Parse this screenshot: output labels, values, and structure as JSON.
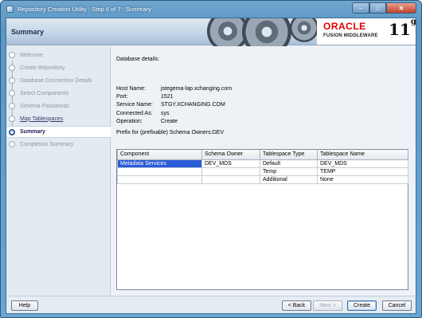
{
  "window": {
    "title": "Repository Creation Utility - Step 6 of 7 : Summary",
    "buttons": {
      "minimize": "–",
      "maximize": "□",
      "close": "✕"
    }
  },
  "header": {
    "title": "Summary",
    "logo": {
      "brand": "ORACLE",
      "product": "FUSION MIDDLEWARE",
      "version": "11",
      "version_sup": "g"
    }
  },
  "nav": {
    "steps": [
      {
        "label": "Welcome",
        "state": "done"
      },
      {
        "label": "Create Repository",
        "state": "done"
      },
      {
        "label": "Database Connection Details",
        "state": "done"
      },
      {
        "label": "Select Components",
        "state": "done"
      },
      {
        "label": "Schema Passwords",
        "state": "done"
      },
      {
        "label": "Map Tablespaces",
        "state": "visited"
      },
      {
        "label": "Summary",
        "state": "active"
      },
      {
        "label": "Completion Summary",
        "state": "pending"
      }
    ]
  },
  "summary": {
    "section_title": "Database details:",
    "details": [
      {
        "key": "Host Name:",
        "value": "jstegema-lap.xchanging.com"
      },
      {
        "key": "Port:",
        "value": "1521"
      },
      {
        "key": "Service Name:",
        "value": "STGY.XCHANGING.COM"
      },
      {
        "key": "Connected As:",
        "value": "sys"
      },
      {
        "key": "Operation:",
        "value": "Create"
      }
    ],
    "prefix_line": "Prefix for (prefixable) Schema Owners:DEV"
  },
  "table": {
    "columns": [
      "Component",
      "Schema Owner",
      "Tablespace Type",
      "Tablespace Name"
    ],
    "rows": [
      [
        "Metadata Services",
        "DEV_MDS",
        "Default",
        "DEV_MDS"
      ],
      [
        "",
        "",
        "Temp",
        "TEMP"
      ],
      [
        "",
        "",
        "Additional",
        "None"
      ]
    ]
  },
  "footer": {
    "help": "Help",
    "back": "< Back",
    "next": "Next >",
    "create": "Create",
    "cancel": "Cancel"
  },
  "colors": {
    "selection": "#2a5bd7",
    "oracle_red": "#e10000"
  }
}
